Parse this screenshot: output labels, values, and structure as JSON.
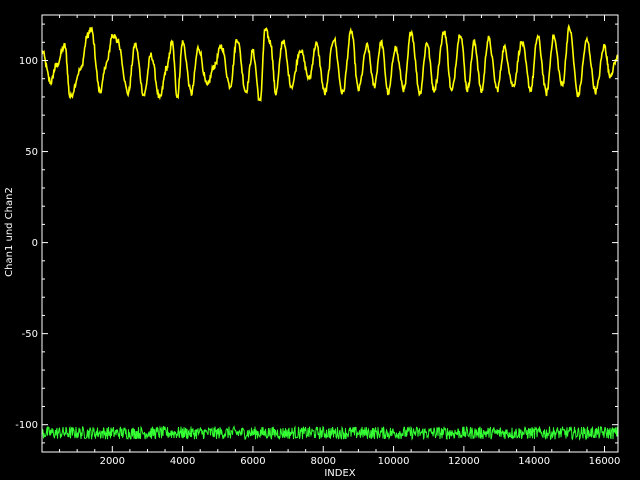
{
  "chart_data": {
    "type": "line",
    "title": "",
    "xlabel": "INDEX",
    "ylabel": "Chan1 und Chan2",
    "xlim": [
      0,
      16384
    ],
    "ylim": [
      -115,
      125
    ],
    "x_ticks": [
      2000,
      4000,
      6000,
      8000,
      10000,
      12000,
      14000,
      16000
    ],
    "x_tick_labels": [
      "2000",
      "4000",
      "6000",
      "8000",
      "10000",
      "12000",
      "14000",
      "16000"
    ],
    "y_ticks": [
      100,
      50,
      0,
      -50,
      -100
    ],
    "y_tick_labels": [
      "100",
      "50",
      "0",
      "-50",
      "-100"
    ],
    "grid": false,
    "legend": "none",
    "background": "#000000",
    "axis_color": "#ffffff",
    "series": [
      {
        "color": "#ffff00",
        "x": [
          0,
          250,
          400,
          650,
          800,
          1100,
          1300,
          1400,
          1650,
          1850,
          2000,
          2150,
          2450,
          2650,
          2900,
          3100,
          3350,
          3550,
          3700,
          3850,
          4000,
          4250,
          4450,
          4700,
          4900,
          5100,
          5350,
          5550,
          5800,
          6000,
          6200,
          6350,
          6500,
          6650,
          6850,
          7100,
          7350,
          7600,
          7800,
          8050,
          8300,
          8550,
          8800,
          9000,
          9250,
          9450,
          9650,
          9850,
          10050,
          10300,
          10500,
          10750,
          10950,
          11150,
          11450,
          11650,
          11900,
          12100,
          12300,
          12500,
          12700,
          12950,
          13150,
          13400,
          13650,
          13900,
          14100,
          14350,
          14550,
          14800,
          15000,
          15250,
          15500,
          15750,
          16000,
          16150,
          16384
        ],
        "y": [
          105,
          88,
          97,
          108,
          80,
          95,
          114,
          117,
          83,
          99,
          114,
          111,
          82,
          109,
          81,
          103,
          79,
          96,
          110,
          80,
          110,
          82,
          107,
          86,
          97,
          108,
          86,
          112,
          83,
          105,
          77,
          117,
          110,
          82,
          111,
          86,
          106,
          90,
          109,
          82,
          112,
          82,
          116,
          84,
          108,
          86,
          110,
          82,
          107,
          84,
          116,
          82,
          110,
          84,
          116,
          83,
          115,
          84,
          110,
          83,
          112,
          84,
          107,
          86,
          110,
          84,
          113,
          82,
          113,
          86,
          118,
          81,
          111,
          83,
          108,
          92,
          102
        ]
      },
      {
        "color": "#33ff33",
        "x": [
          0,
          16384
        ],
        "y": [
          -104.5,
          -104.5
        ],
        "noise_band": [
          -108,
          -101
        ]
      }
    ]
  }
}
